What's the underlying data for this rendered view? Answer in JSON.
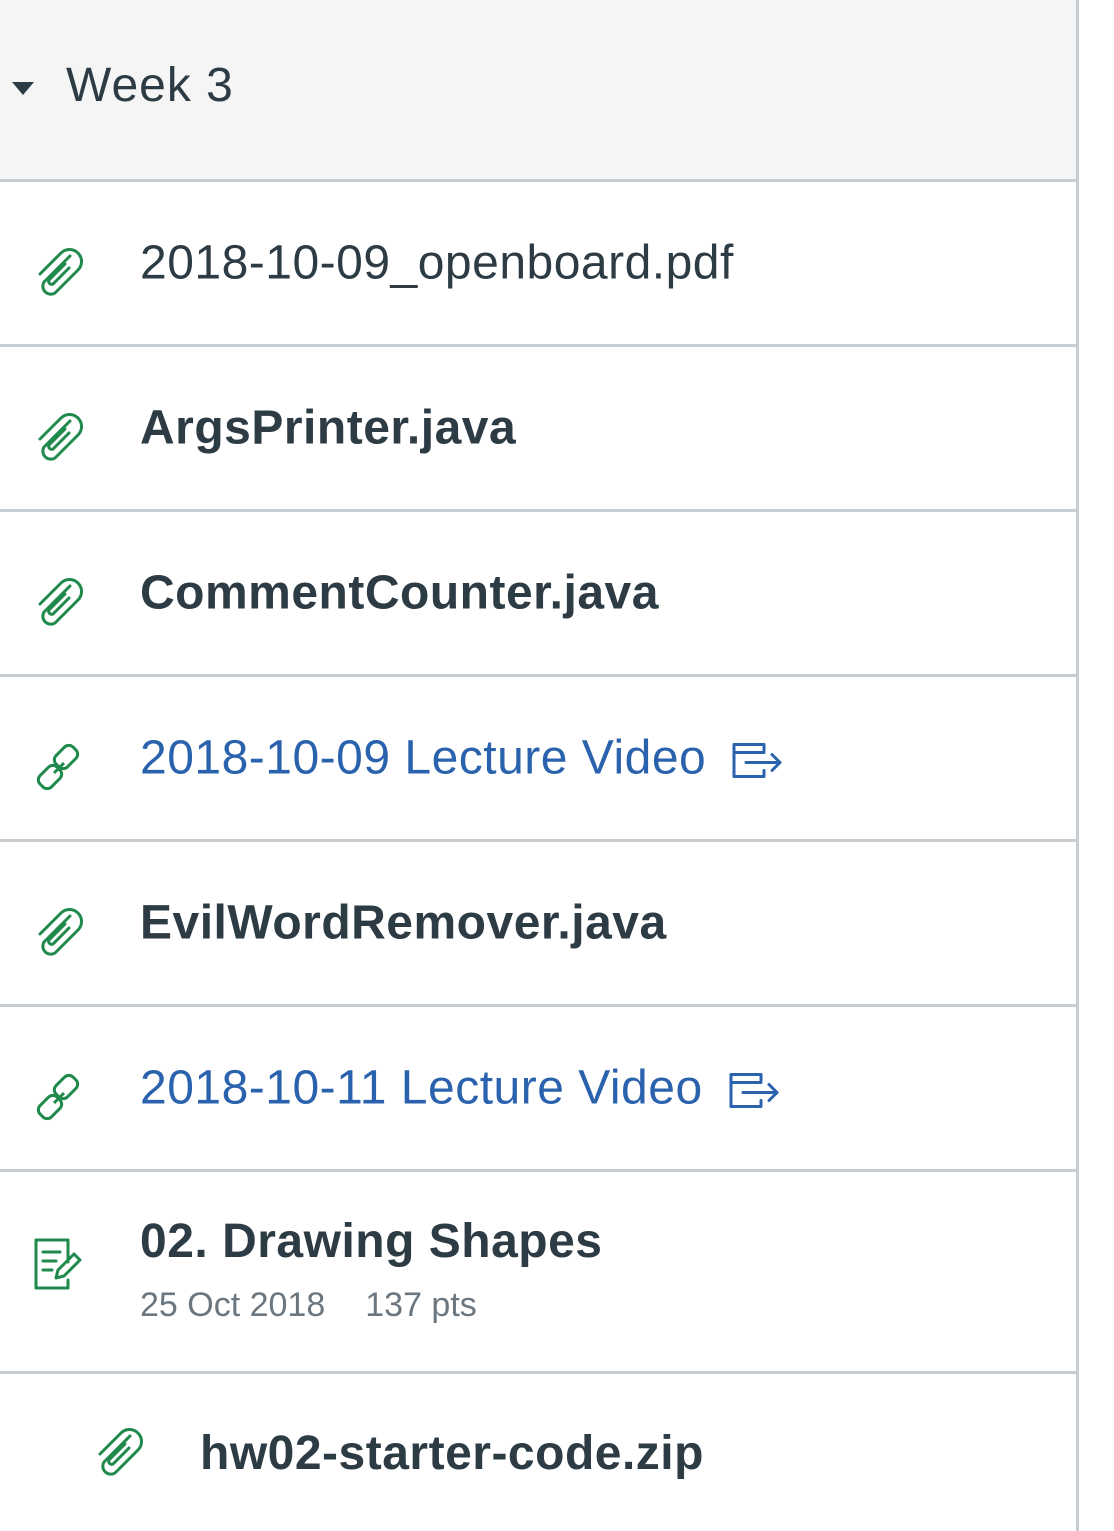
{
  "module": {
    "title": "Week 3",
    "items": [
      {
        "type": "attachment",
        "title": "2018-10-09_openboard.pdf",
        "style": "light"
      },
      {
        "type": "attachment",
        "title": "ArgsPrinter.java",
        "style": "bold"
      },
      {
        "type": "attachment",
        "title": "CommentCounter.java",
        "style": "bold"
      },
      {
        "type": "external-link",
        "title": "2018-10-09 Lecture Video"
      },
      {
        "type": "attachment",
        "title": "EvilWordRemover.java",
        "style": "bold"
      },
      {
        "type": "external-link",
        "title": "2018-10-11 Lecture Video"
      },
      {
        "type": "assignment",
        "title": "02. Drawing Shapes",
        "due": "25 Oct 2018",
        "points": "137 pts"
      },
      {
        "type": "attachment",
        "title": "hw02-starter-code.zip",
        "style": "bold",
        "indent": true
      }
    ]
  },
  "colors": {
    "icon_green": "#1f8a4c",
    "link_blue": "#2a62ad",
    "text": "#2d3b45",
    "border": "#c7cdd1",
    "header_bg": "#f5f5f5"
  },
  "icons": {
    "attachment": "paperclip-icon",
    "external-link": "link-icon",
    "assignment": "assignment-icon",
    "external": "external-link-icon"
  }
}
